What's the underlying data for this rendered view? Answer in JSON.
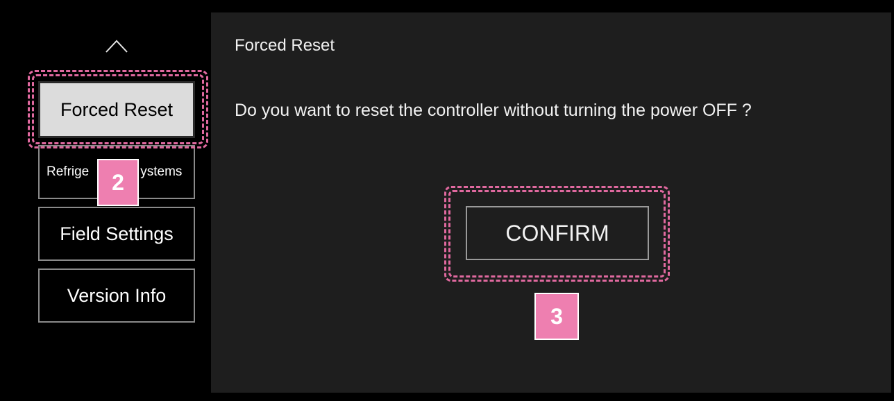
{
  "sidebar": {
    "items": [
      {
        "label": "Forced Reset",
        "active": true
      },
      {
        "label": "Refrigerant Systems",
        "visible_label_left": "Refrige",
        "visible_label_right": "ystems"
      },
      {
        "label": "Field Settings"
      },
      {
        "label": "Version Info"
      }
    ]
  },
  "main": {
    "title": "Forced Reset",
    "question": "Do you want to reset the controller without turning the power OFF ?",
    "confirm_label": "CONFIRM"
  },
  "annotations": {
    "step_2": "2",
    "step_3": "3"
  },
  "colors": {
    "background": "#000000",
    "panel": "#1e1e1e",
    "active_item": "#dcdcdc",
    "highlight": "#e0699f",
    "badge": "#ee7fb0"
  },
  "icons": {
    "scroll_up": "chevron-up-icon"
  }
}
